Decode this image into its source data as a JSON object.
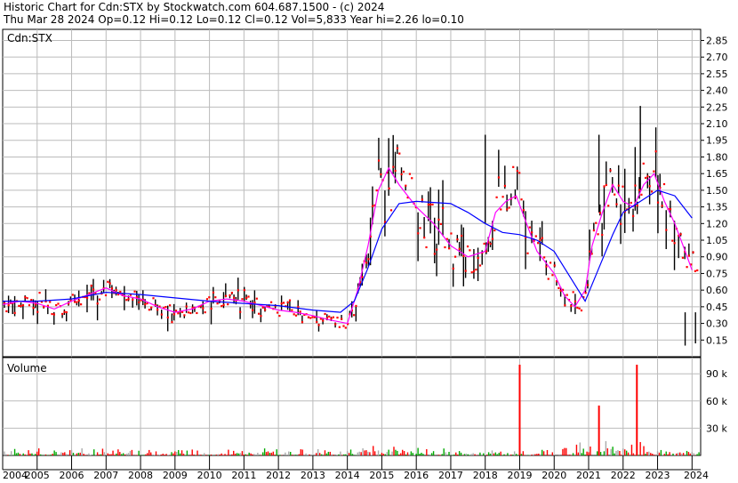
{
  "header": {
    "line1": "Historic Chart for Cdn:STX by Stockwatch.com 604.687.1500 - (c) 2024",
    "line2": "Thu Mar 28 2024   Op=0.12  Hi=0.12  Lo=0.12  Cl=0.12  Vol=5,833  Year hi=2.26  lo=0.10"
  },
  "chart_data": [
    {
      "type": "line",
      "panel": "price",
      "symbol_label": "Cdn:STX",
      "ylim": [
        0.0,
        2.95
      ],
      "y_ticks": [
        "2.85",
        "2.70",
        "2.55",
        "2.40",
        "2.25",
        "2.10",
        "1.95",
        "1.80",
        "1.65",
        "1.50",
        "1.35",
        "1.20",
        "1.05",
        "0.90",
        "0.75",
        "0.60",
        "0.45",
        "0.30",
        "0.15"
      ],
      "x_ticks": [
        "2004",
        "2005",
        "2006",
        "2007",
        "2008",
        "2009",
        "2010",
        "2011",
        "2012",
        "2013",
        "2014",
        "2015",
        "2016",
        "2017",
        "2018",
        "2019",
        "2020",
        "2021",
        "2022",
        "2023",
        "2024"
      ],
      "grid": true,
      "colors": {
        "price_bars": "#000000",
        "closes": "#ff0000",
        "ma_short": "#ff00ff",
        "ma_long": "#0000ff"
      },
      "series": [
        {
          "role": "ma_short",
          "x": [
            2004.0,
            2004.5,
            2005.0,
            2005.5,
            2006.0,
            2006.5,
            2007.0,
            2007.5,
            2008.0,
            2008.5,
            2009.0,
            2009.5,
            2010.0,
            2010.5,
            2011.0,
            2011.5,
            2012.0,
            2012.5,
            2013.0,
            2013.5,
            2014.0,
            2014.3,
            2014.6,
            2014.9,
            2015.2,
            2015.5,
            2016.0,
            2016.5,
            2017.0,
            2017.5,
            2018.0,
            2018.3,
            2018.6,
            2018.9,
            2019.2,
            2019.5,
            2020.0,
            2020.3,
            2020.6,
            2020.9,
            2021.1,
            2021.4,
            2021.7,
            2022.0,
            2022.3,
            2022.6,
            2022.9,
            2023.2,
            2023.5,
            2023.8,
            2024.0
          ],
          "values": [
            0.47,
            0.5,
            0.48,
            0.43,
            0.5,
            0.56,
            0.62,
            0.55,
            0.52,
            0.45,
            0.4,
            0.43,
            0.5,
            0.52,
            0.5,
            0.46,
            0.42,
            0.4,
            0.37,
            0.33,
            0.3,
            0.6,
            1.0,
            1.5,
            1.7,
            1.55,
            1.35,
            1.2,
            1.0,
            0.9,
            0.95,
            1.3,
            1.4,
            1.45,
            1.2,
            0.95,
            0.75,
            0.55,
            0.45,
            0.6,
            1.0,
            1.3,
            1.55,
            1.4,
            1.35,
            1.55,
            1.65,
            1.4,
            1.2,
            0.95,
            0.78
          ]
        },
        {
          "role": "ma_long",
          "x": [
            2004.0,
            2005.0,
            2006.0,
            2007.0,
            2008.0,
            2009.0,
            2010.0,
            2011.0,
            2012.0,
            2013.0,
            2013.8,
            2014.2,
            2014.6,
            2015.0,
            2015.5,
            2016.0,
            2017.0,
            2017.5,
            2018.0,
            2018.5,
            2019.0,
            2019.5,
            2020.0,
            2020.5,
            2020.9,
            2021.3,
            2021.7,
            2022.0,
            2022.5,
            2023.0,
            2023.5,
            2024.0
          ],
          "values": [
            0.5,
            0.5,
            0.52,
            0.58,
            0.56,
            0.53,
            0.5,
            0.48,
            0.46,
            0.42,
            0.4,
            0.5,
            0.8,
            1.15,
            1.38,
            1.4,
            1.38,
            1.3,
            1.2,
            1.12,
            1.1,
            1.05,
            0.95,
            0.7,
            0.5,
            0.8,
            1.1,
            1.3,
            1.4,
            1.5,
            1.45,
            1.25
          ]
        }
      ]
    },
    {
      "type": "bar",
      "panel": "volume",
      "label": "Volume",
      "y_ticks": [
        "90 k",
        "60 k",
        "30 k"
      ],
      "ylim": [
        0,
        100
      ],
      "unit": "k",
      "colors": {
        "up": "#00aa00",
        "down": "#ff0000",
        "flat": "#aaaaaa"
      },
      "notable_values": [
        {
          "x": 2019.0,
          "value": 100
        },
        {
          "x": 2021.3,
          "value": 55
        },
        {
          "x": 2022.4,
          "value": 100
        }
      ]
    }
  ]
}
